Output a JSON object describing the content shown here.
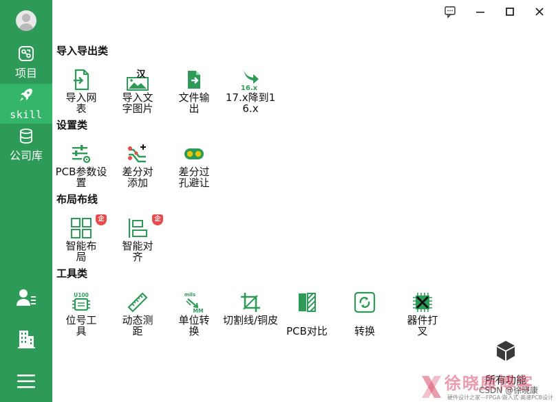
{
  "sidebar": {
    "items": [
      {
        "label": "项目",
        "icon": "project-icon"
      },
      {
        "label": "skill",
        "icon": "rocket-icon"
      },
      {
        "label": "公司库",
        "icon": "database-icon"
      }
    ],
    "bottom_icons": [
      "user-list-icon",
      "building-icon",
      "menu-icon"
    ]
  },
  "window_controls": [
    "feedback-icon",
    "minimize-icon",
    "maximize-icon",
    "close-icon"
  ],
  "sections": [
    {
      "title": "导入导出类",
      "tools": [
        {
          "label": "导入网表",
          "icon": "import-netlist-icon"
        },
        {
          "label": "导入文字图片",
          "icon": "import-text-image-icon",
          "icon_text": "汉"
        },
        {
          "label": "文件输出",
          "icon": "file-output-icon"
        },
        {
          "label": "17.x降到16.x",
          "icon": "downgrade-icon",
          "icon_text": "16.x"
        }
      ]
    },
    {
      "title": "设置类",
      "tools": [
        {
          "label": "PCB参数设置",
          "icon": "pcb-settings-icon"
        },
        {
          "label": "差分对添加",
          "icon": "diff-pair-add-icon"
        },
        {
          "label": "差分过孔避让",
          "icon": "diff-via-avoid-icon"
        }
      ]
    },
    {
      "title": "布局布线",
      "tools": [
        {
          "label": "智能布局",
          "icon": "smart-layout-icon",
          "badge": "企"
        },
        {
          "label": "智能对齐",
          "icon": "smart-align-icon",
          "badge": "企"
        }
      ]
    },
    {
      "title": "工具类",
      "tools": [
        {
          "label": "位号工具",
          "icon": "refdes-tool-icon",
          "icon_text": "U100"
        },
        {
          "label": "动态测距",
          "icon": "ruler-icon"
        },
        {
          "label": "单位转换",
          "icon": "unit-convert-icon",
          "icon_text": "mils",
          "icon_text2": "MM"
        },
        {
          "label": "切割线/铜皮",
          "icon": "crop-icon"
        },
        {
          "label": "PCB对比",
          "icon": "pcb-compare-icon"
        },
        {
          "label": "转换",
          "icon": "convert-icon"
        },
        {
          "label": "器件打叉",
          "icon": "component-cross-icon"
        }
      ]
    }
  ],
  "all_functions": {
    "label": "所有功能",
    "icon": "cube-icon"
  },
  "watermark": {
    "title": "徐晓康博客",
    "sub": "硬件设计之家—FPGA·嵌入式·高速PCB设计",
    "csdn": "CSDN @徐晓康"
  },
  "colors": {
    "sidebar": "#2e9a57",
    "sidebar_active": "#35b569",
    "accent": "#2e9a57",
    "badge": "#e74b4b"
  }
}
